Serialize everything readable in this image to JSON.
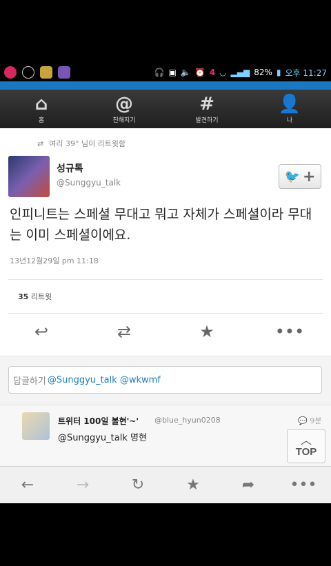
{
  "status_bar": {
    "battery": "82%",
    "time": "오후 11:27",
    "icons": [
      "uplus-icon",
      "notification-icon",
      "app-icon-1",
      "app-icon-2",
      "headset-icon",
      "screen-icon",
      "volume-icon",
      "alarm-icon",
      "lte-icon",
      "wifi-icon",
      "signal-icon",
      "battery-icon"
    ]
  },
  "nav": {
    "items": [
      {
        "icon": "home-icon",
        "label": "홈"
      },
      {
        "icon": "mention-icon",
        "label": "친해지기"
      },
      {
        "icon": "hashtag-icon",
        "label": "발견하기"
      },
      {
        "icon": "profile-icon",
        "label": "나"
      }
    ]
  },
  "tweet": {
    "retweeted_by": "여리 39° 님이 리트윗함",
    "name": "성규톡",
    "handle": "@Sunggyu_talk",
    "text": "인피니트는 스페셜 무대고 뭐고 자체가 스페셜이라 무대는 이미 스페셜이에요.",
    "timestamp": "13년12월29일 pm 11:18",
    "retweet_count": "35",
    "retweet_label": "리트윗"
  },
  "reply_box": {
    "placeholder": "답글하기",
    "value": "@Sunggyu_talk @wkwmf"
  },
  "reply": {
    "name": "트위터 100일 볼현'~'",
    "handle": "@blue_hyun0208",
    "time": "9분",
    "text": "@Sunggyu_talk 명현"
  },
  "top_button": {
    "label": "TOP"
  },
  "browser_bar": {
    "items": [
      "back-icon",
      "forward-icon",
      "refresh-icon",
      "bookmark-icon",
      "share-icon",
      "more-icon"
    ]
  }
}
